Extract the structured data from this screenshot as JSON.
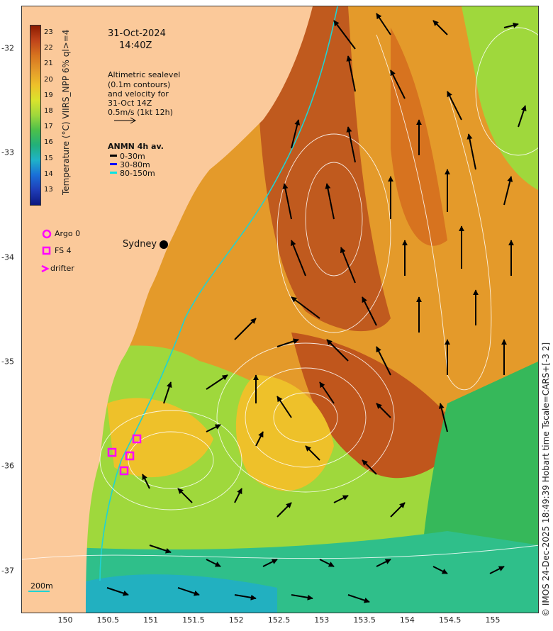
{
  "header": {
    "date": "31-Oct-2024",
    "time": "14:40Z"
  },
  "sealevel_note": {
    "line1": "Altimetric sealevel",
    "line2": "(0.1m contours)",
    "line3": "and velocity for",
    "line4": "31-Oct 14Z",
    "scale": "0.5m/s (1kt 12h)"
  },
  "anmn": {
    "title": "ANMN 4h av.",
    "items": [
      {
        "label": "0-30m",
        "color": "#000000"
      },
      {
        "label": "30-80m",
        "color": "#0000ff"
      },
      {
        "label": "80-150m",
        "color": "#00e5e5"
      }
    ]
  },
  "colorbar": {
    "label": "Temperature (°C) VIIRS_NPP 6% ql>=4",
    "ticks": [
      "23",
      "22",
      "21",
      "20",
      "19",
      "18",
      "17",
      "16",
      "15",
      "14",
      "13"
    ],
    "colors": [
      "#8b1a00",
      "#c0441a",
      "#d7731f",
      "#e49a2a",
      "#eec12a",
      "#d9e32d",
      "#9fd83c",
      "#4cc04a",
      "#22b07a",
      "#1fb3c8",
      "#1a6fd8",
      "#1f3db8",
      "#0d1880"
    ]
  },
  "markers": {
    "argo": "Argo 0",
    "fs": "FS 4",
    "drifter": "drifter",
    "argo_color": "#ff00ff"
  },
  "places": {
    "sydney": "Sydney",
    "isobath": "200m"
  },
  "axes": {
    "x_ticks": [
      "150",
      "150.5",
      "151",
      "151.5",
      "152",
      "152.5",
      "153",
      "153.5",
      "154",
      "154.5",
      "155"
    ],
    "y_ticks": [
      "-32",
      "-33",
      "-34",
      "-35",
      "-36",
      "-37"
    ]
  },
  "credit": "© IMOS 24-Dec-2025 18:49:39 Hobart time Tscale=CARS+[-3 2]",
  "colors": {
    "land": "#fbc99a",
    "warm": "#d9761f",
    "hot": "#b8521a",
    "mid": "#eeb52a",
    "cool": "#9fd83c",
    "cold": "#36b85a",
    "isobath": "#1fd3d3"
  }
}
